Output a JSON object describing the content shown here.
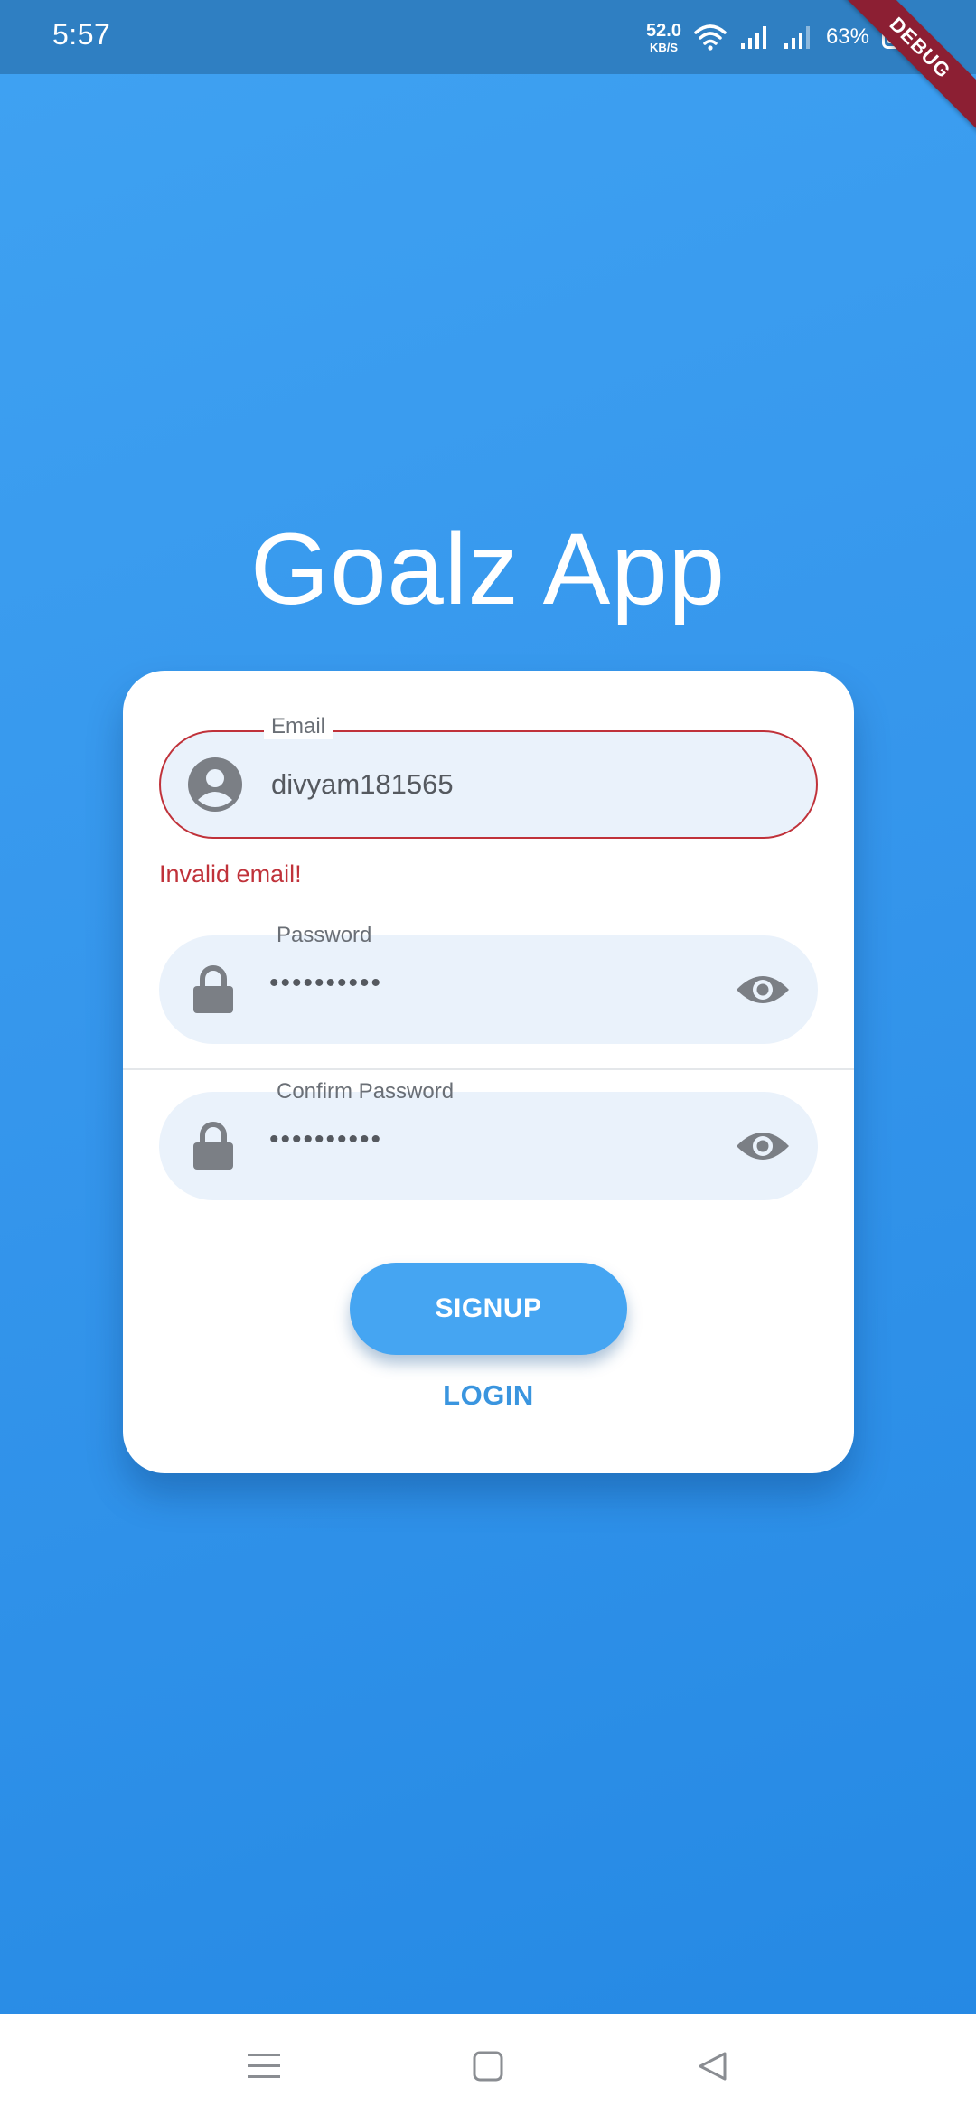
{
  "status_bar": {
    "time": "5:57",
    "net_speed": "52.0",
    "net_speed_unit": "KB/S",
    "battery": "63%",
    "icons": [
      "wifi-icon",
      "signal-icon",
      "signal-icon",
      "battery-icon"
    ]
  },
  "debug_banner": "DEBUG",
  "app": {
    "title": "Goalz App"
  },
  "form": {
    "email": {
      "label": "Email",
      "value": "divyam181565",
      "error": "Invalid email!",
      "icon": "account-circle-icon"
    },
    "password": {
      "label": "Password",
      "value": "••••••••••",
      "icon": "lock-icon",
      "toggle_icon": "eye-icon"
    },
    "confirm_password": {
      "label": "Confirm Password",
      "value": "••••••••••",
      "icon": "lock-icon",
      "toggle_icon": "eye-icon"
    },
    "signup_label": "SIGNUP",
    "login_label": "LOGIN"
  },
  "nav_bar": {
    "buttons": [
      "menu-icon",
      "home-icon",
      "back-icon"
    ]
  },
  "colors": {
    "background": "#3596ec",
    "accent": "#45a5f2",
    "error": "#c0323a",
    "field_fill": "#eaf2fb",
    "debug_ribbon": "#8c1f33"
  }
}
